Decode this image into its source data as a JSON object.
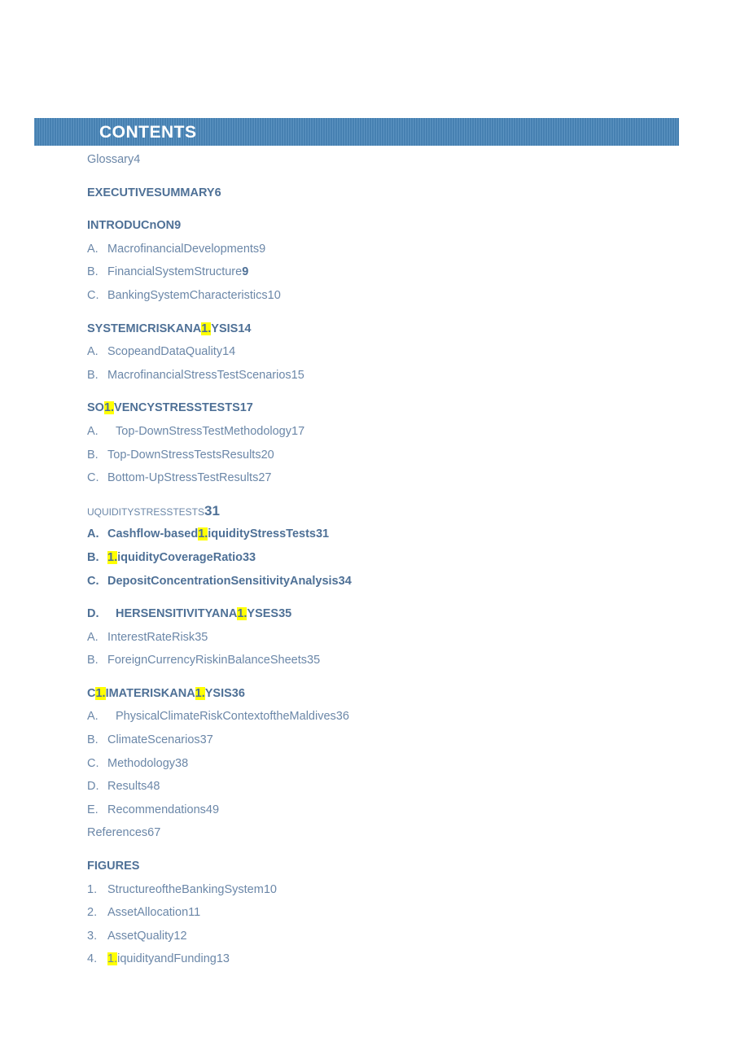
{
  "banner": {
    "title": "CONTENTS",
    "bar_color": "#4a87ba",
    "title_color": "#ffffff"
  },
  "colors": {
    "body_text": "#6b87a8",
    "heading_text": "#4e7096",
    "highlight": "#ffff00"
  },
  "toc": {
    "entries": [
      {
        "id": "glossary",
        "label": "",
        "text_pre": "Glossary",
        "hl": "",
        "text_post": "4",
        "style": "plain-flush"
      },
      {
        "id": "executive-summary",
        "label": "",
        "text_pre": "EXECUTIVESUMMARY",
        "hl": "",
        "text_post": "6",
        "style": "bold-flush",
        "gap": true
      },
      {
        "id": "introduction",
        "label": "",
        "text_pre": "INTRODUCnON",
        "hl": "",
        "text_post": "9",
        "style": "bold-flush",
        "gap": true
      },
      {
        "id": "intro-a",
        "label": "A.",
        "text_pre": "MacrofinancialDevelopments",
        "hl": "",
        "text_post": "9",
        "style": "plain"
      },
      {
        "id": "intro-b",
        "label": "B.",
        "text_pre": "FinancialSystemStructure",
        "hl": "",
        "text_post": "9",
        "style": "plain-boldpage"
      },
      {
        "id": "intro-c",
        "label": "C.",
        "text_pre": "BankingSystemCharacteristics",
        "hl": "",
        "text_post": "10",
        "style": "plain"
      },
      {
        "id": "systemic-risk",
        "label": "",
        "text_pre": "SYSTEMICRISKANA",
        "hl": "1.",
        "text_post": "YSIS14",
        "style": "bold-flush",
        "gap": true
      },
      {
        "id": "systemic-a",
        "label": "A.",
        "text_pre": "ScopeandDataQuality",
        "hl": "",
        "text_post": "14",
        "style": "plain"
      },
      {
        "id": "systemic-b",
        "label": "B.",
        "text_pre": "MacrofinancialStressTestScenarios",
        "hl": "",
        "text_post": "15",
        "style": "plain"
      },
      {
        "id": "solvency",
        "label": "",
        "text_pre": "SO",
        "hl": "1.",
        "text_post": "VENCYSTRESSTESTS17",
        "style": "bold-flush",
        "gap": true
      },
      {
        "id": "solvency-a",
        "label": "A.",
        "text_pre": "Top-DownStressTestMethodology",
        "hl": "",
        "text_post": "17",
        "style": "plain-wide"
      },
      {
        "id": "solvency-b",
        "label": "B.",
        "text_pre": "Top-DownStressTestsResults",
        "hl": "",
        "text_post": "20",
        "style": "plain"
      },
      {
        "id": "solvency-c",
        "label": "C.",
        "text_pre": "Bottom-UpStressTestResults",
        "hl": "",
        "text_post": "27",
        "style": "plain"
      },
      {
        "id": "liquidity",
        "label": "",
        "text_pre": "UQUIDITYSTRESSTESTS",
        "hl": "",
        "text_post": "31",
        "style": "smallcaps-flush",
        "gap": true
      },
      {
        "id": "liquidity-a",
        "label": "A.",
        "text_pre": "Cashflow-based",
        "hl": "1.",
        "text_post": "iquidityStressTests31",
        "style": "boldlabel"
      },
      {
        "id": "liquidity-b",
        "label": "B.",
        "text_pre": "",
        "hl": "1.",
        "text_post": "iquidityCoverageRatio33",
        "style": "boldlabel"
      },
      {
        "id": "liquidity-c",
        "label": "C.",
        "text_pre": "DepositConcentrationSensitivityAnalysis",
        "hl": "",
        "text_post": "34",
        "style": "boldlabel"
      },
      {
        "id": "other-sensitivity",
        "label": "D.",
        "text_pre": "HERSENSITIVITYANA",
        "hl": "1.",
        "text_post": "YSES35",
        "style": "bold-wide",
        "gap": true
      },
      {
        "id": "other-a",
        "label": "A.",
        "text_pre": "InterestRateRisk",
        "hl": "",
        "text_post": "35",
        "style": "plain"
      },
      {
        "id": "other-b",
        "label": "B.",
        "text_pre": "ForeignCurrencyRiskinBalanceSheets",
        "hl": "",
        "text_post": "35",
        "style": "plain"
      },
      {
        "id": "climate-risk",
        "label": "",
        "text_pre": "C",
        "hl": "1.",
        "text_post": "IMATERISKANA",
        "hl2": "1.",
        "text_post2": "YSIS36",
        "style": "bold-flush-double",
        "gap": true
      },
      {
        "id": "climate-a",
        "label": "A.",
        "text_pre": "PhysicalClimateRiskContextoftheMaldives",
        "hl": "",
        "text_post": "36",
        "style": "plain-wide"
      },
      {
        "id": "climate-b",
        "label": "B.",
        "text_pre": "ClimateScenarios",
        "hl": "",
        "text_post": "37",
        "style": "plain"
      },
      {
        "id": "climate-c",
        "label": "C.",
        "text_pre": "Methodology",
        "hl": "",
        "text_post": "38",
        "style": "plain"
      },
      {
        "id": "climate-d",
        "label": "D.",
        "text_pre": "Results",
        "hl": "",
        "text_post": "48",
        "style": "plain"
      },
      {
        "id": "climate-e",
        "label": "E.",
        "text_pre": "Recommendations",
        "hl": "",
        "text_post": "49",
        "style": "plain"
      },
      {
        "id": "references",
        "label": "",
        "text_pre": "References",
        "hl": "",
        "text_post": "67",
        "style": "plain-flush"
      },
      {
        "id": "figures-heading",
        "label": "",
        "text_pre": "FIGURES",
        "hl": "",
        "text_post": "",
        "style": "bold-flush",
        "gap": true
      },
      {
        "id": "figure-1",
        "label": "1.",
        "text_pre": "StructureoftheBankingSystem",
        "hl": "",
        "text_post": "10",
        "style": "plain"
      },
      {
        "id": "figure-2",
        "label": "2.",
        "text_pre": "AssetAllocation",
        "hl": "",
        "text_post": "11",
        "style": "plain"
      },
      {
        "id": "figure-3",
        "label": "3.",
        "text_pre": "AssetQuality",
        "hl": "",
        "text_post": "12",
        "style": "plain"
      },
      {
        "id": "figure-4",
        "label": "4.",
        "text_pre": "",
        "hl": "1.",
        "text_post": "iquidityandFunding13",
        "style": "plain"
      }
    ]
  }
}
